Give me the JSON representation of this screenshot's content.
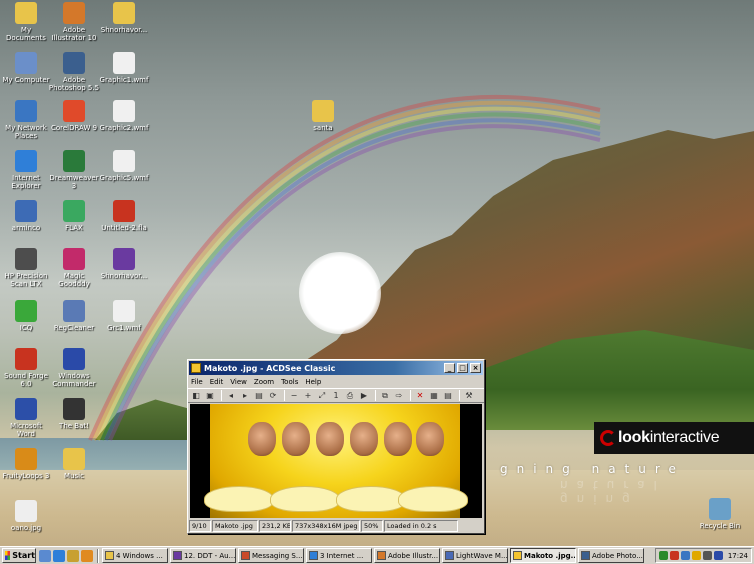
{
  "desktop": {
    "icons": [
      {
        "label": "My Documents",
        "icon": "folder-documents-icon",
        "color": "#e8c44a"
      },
      {
        "label": "My Computer",
        "icon": "computer-icon",
        "color": "#6b8fc9"
      },
      {
        "label": "My Network Places",
        "icon": "network-icon",
        "color": "#3a76c2"
      },
      {
        "label": "Internet Explorer",
        "icon": "internet-explorer-icon",
        "color": "#2f7fd8"
      },
      {
        "label": "arminco",
        "icon": "app-icon",
        "color": "#3d6bb5"
      },
      {
        "label": "HP Precision Scan LTX",
        "icon": "scanner-icon",
        "color": "#4d4d4d"
      },
      {
        "label": "ICQ",
        "icon": "icq-icon",
        "color": "#3aa83a"
      },
      {
        "label": "Sound Forge 6.0",
        "icon": "sound-forge-icon",
        "color": "#c8331f"
      },
      {
        "label": "Microsoft Word",
        "icon": "word-icon",
        "color": "#2c4fa8"
      },
      {
        "label": "FruityLoops 3",
        "icon": "fruityloops-icon",
        "color": "#d98b18"
      },
      {
        "label": "oano.jpg",
        "icon": "image-file-icon",
        "color": "#eeeeee"
      },
      {
        "label": "Adobe Illustrator 10",
        "icon": "illustrator-icon",
        "color": "#d4782a"
      },
      {
        "label": "Adobe Photoshop 5.5",
        "icon": "photoshop-icon",
        "color": "#3b5f8e"
      },
      {
        "label": "CorelDRAW 9",
        "icon": "coreldraw-icon",
        "color": "#e04a2a"
      },
      {
        "label": "Dreamweaver 3",
        "icon": "dreamweaver-icon",
        "color": "#2a7a3a"
      },
      {
        "label": "FLAX",
        "icon": "flax-icon",
        "color": "#3aa860"
      },
      {
        "label": "Magic Goodddy",
        "icon": "magic-goodddy-icon",
        "color": "#c22a6a"
      },
      {
        "label": "RegCleaner",
        "icon": "regcleaner-icon",
        "color": "#5a7ab5"
      },
      {
        "label": "Windows Commander",
        "icon": "windows-commander-icon",
        "color": "#2a4aa8"
      },
      {
        "label": "The Bat!",
        "icon": "the-bat-icon",
        "color": "#333333"
      },
      {
        "label": "Music",
        "icon": "folder-music-icon",
        "color": "#e8c44a"
      },
      {
        "label": "Shnorhavor...",
        "icon": "folder-icon",
        "color": "#e8c44a"
      },
      {
        "label": "Graphic1.wmf",
        "icon": "wmf-file-icon",
        "color": "#f0f0f0"
      },
      {
        "label": "Graphic2.wmf",
        "icon": "wmf-file-icon",
        "color": "#f0f0f0"
      },
      {
        "label": "Graphic5.wmf",
        "icon": "wmf-file-icon",
        "color": "#f0f0f0"
      },
      {
        "label": "Untitled-2.fla",
        "icon": "fla-file-icon",
        "color": "#c8331f"
      },
      {
        "label": "Shnorhavor...",
        "icon": "winrar-icon",
        "color": "#6a3aa0"
      },
      {
        "label": "Grc1.wmf",
        "icon": "wmf-file-icon",
        "color": "#f0f0f0"
      },
      {
        "label": "santa",
        "icon": "folder-icon",
        "color": "#e8c44a"
      },
      {
        "label": "Recycle Bin",
        "icon": "recycle-bin-icon",
        "color": "#6aa0c8"
      }
    ],
    "brand": "look",
    "brand_suffix": "interactive",
    "tagline": "gning nature",
    "tagline_reflection": "gning natural"
  },
  "acdsee": {
    "title": "Makoto .jpg - ACDSee Classic",
    "menu": [
      "File",
      "Edit",
      "View",
      "Zoom",
      "Tools",
      "Help"
    ],
    "toolbar": [
      "browse-icon",
      "open-icon",
      "prev-icon",
      "next-icon",
      "fit-icon",
      "refresh-icon",
      "zoom-out-icon",
      "zoom-in-icon",
      "zoom-fit-icon",
      "zoom-actual-icon",
      "print-icon",
      "slideshow-icon",
      "copy-icon",
      "move-icon",
      "delete-icon",
      "wallpaper-icon",
      "properties-icon",
      "acdsee-icon"
    ],
    "status": {
      "index": "9/10",
      "file": "Makoto .jpg",
      "size": "231,2 KB",
      "dims": "737x348x16M jpeg",
      "zoom": "50%",
      "load": "Loaded in 0.2 s"
    }
  },
  "taskbar": {
    "start": "Start",
    "quick_launch": [
      "desktop-icon",
      "ie-icon",
      "outlook-icon",
      "media-icon"
    ],
    "tasks": [
      {
        "label": "4 Windows ...",
        "active": false,
        "color": "#e8c44a"
      },
      {
        "label": "12. DDT - Au...",
        "active": false,
        "color": "#6a3aa0"
      },
      {
        "label": "Messaging S...",
        "active": false,
        "color": "#c84a2a"
      },
      {
        "label": "3 Internet ...",
        "active": false,
        "color": "#2f7fd8"
      },
      {
        "label": "Adobe Illustr...",
        "active": false,
        "color": "#d4782a"
      },
      {
        "label": "LightWave M...",
        "active": false,
        "color": "#4a6ab5"
      },
      {
        "label": "Makoto .jpg...",
        "active": true,
        "color": "#f4c430"
      },
      {
        "label": "Adobe Photo...",
        "active": false,
        "color": "#3b5f8e"
      }
    ],
    "tray": [
      "#2a8a2a",
      "#c8331f",
      "#3a76c2",
      "#e0a800",
      "#555555",
      "#2a4aa8"
    ],
    "clock": "17:24"
  }
}
